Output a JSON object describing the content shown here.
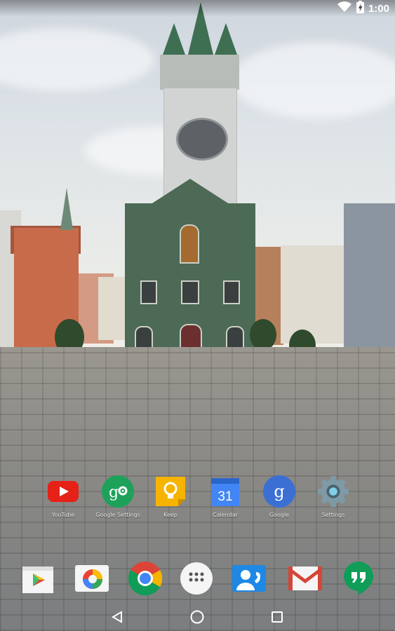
{
  "status_bar": {
    "time": "1:00",
    "icons": [
      "wifi-icon",
      "battery-charging-icon"
    ]
  },
  "home": {
    "apps": [
      {
        "label": "YouTube",
        "icon": "youtube-icon",
        "color": "#e62117"
      },
      {
        "label": "Google Settings",
        "icon": "google-settings-icon",
        "color": "#1ea15a"
      },
      {
        "label": "Keep",
        "icon": "keep-icon",
        "color": "#f6b400"
      },
      {
        "label": "Calendar",
        "icon": "calendar-icon",
        "color": "#4285f4",
        "day": "31"
      },
      {
        "label": "Google",
        "icon": "google-search-icon",
        "color": "#3b6fd4",
        "glyph": "g"
      },
      {
        "label": "Settings",
        "icon": "settings-icon",
        "color": "#78909c"
      }
    ]
  },
  "dock": {
    "items": [
      {
        "name": "play-store",
        "icon": "play-store-icon"
      },
      {
        "name": "photos",
        "icon": "photos-icon"
      },
      {
        "name": "chrome",
        "icon": "chrome-icon"
      },
      {
        "name": "app-drawer",
        "icon": "app-drawer-icon"
      },
      {
        "name": "contacts",
        "icon": "contacts-icon"
      },
      {
        "name": "gmail",
        "icon": "gmail-icon"
      },
      {
        "name": "hangouts",
        "icon": "hangouts-icon"
      }
    ]
  },
  "nav": {
    "buttons": [
      {
        "name": "back",
        "icon": "back-icon"
      },
      {
        "name": "home",
        "icon": "home-icon"
      },
      {
        "name": "recents",
        "icon": "recents-icon"
      }
    ]
  },
  "colors": {
    "youtube": "#e62117",
    "chrome_red": "#db4437",
    "chrome_yellow": "#f4b400",
    "chrome_green": "#0f9d58",
    "chrome_blue": "#4285f4",
    "hangouts": "#0f9d58",
    "contacts": "#1e88e5"
  }
}
